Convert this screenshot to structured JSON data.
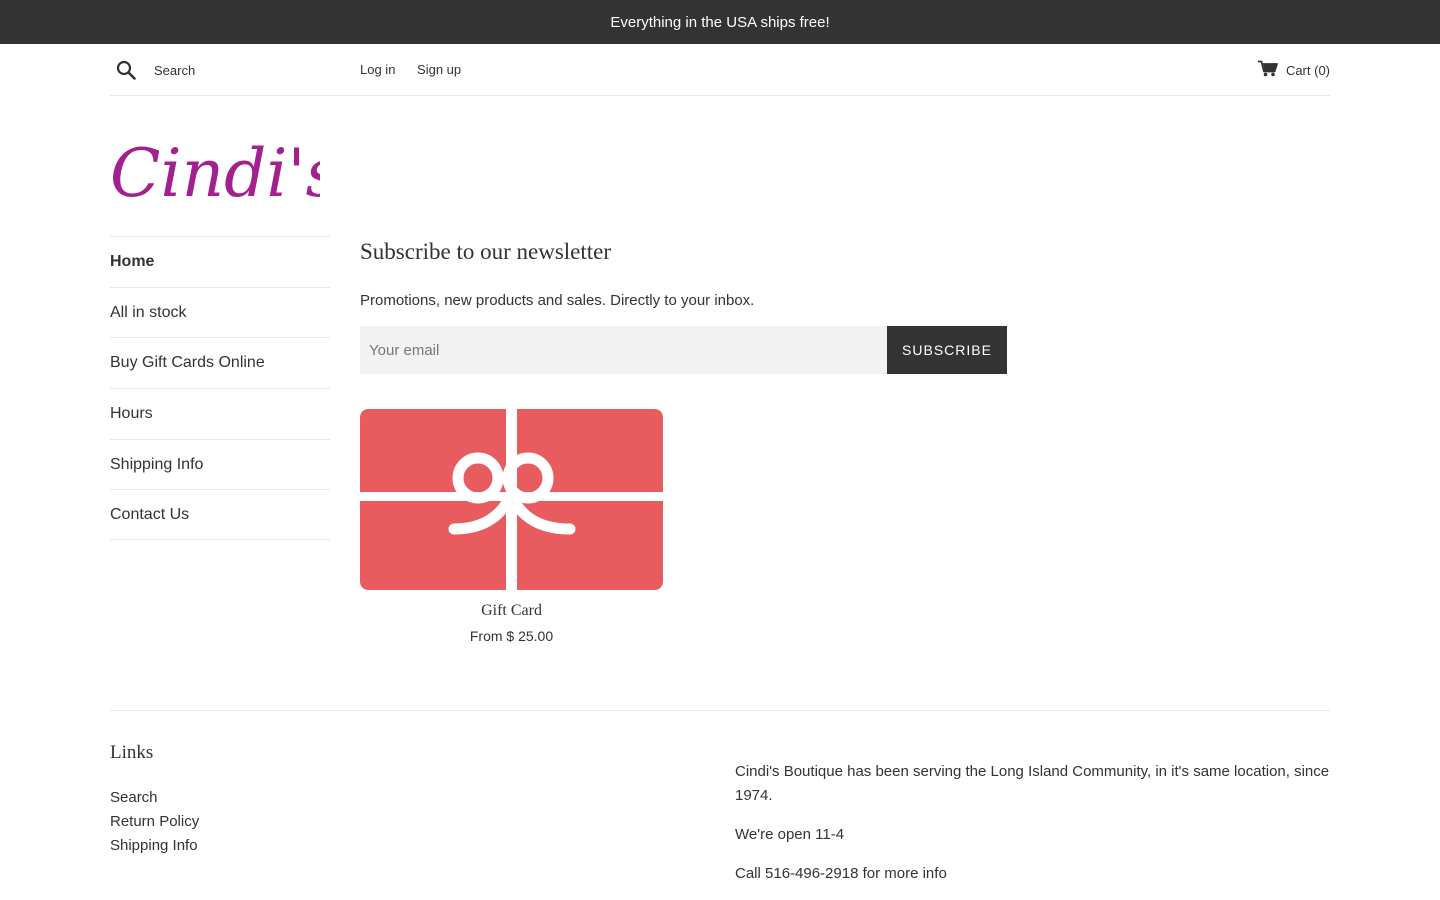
{
  "announcement": {
    "text": "Everything in the USA ships free!"
  },
  "header": {
    "search_placeholder": "Search",
    "login_label": "Log in",
    "signup_label": "Sign up",
    "cart_label": "Cart (0)"
  },
  "logo": {
    "text": "Cindi's",
    "color": "#a3208f"
  },
  "sidebar": {
    "items": [
      {
        "label": "Home",
        "active": true
      },
      {
        "label": "All in stock"
      },
      {
        "label": "Buy Gift Cards Online"
      },
      {
        "label": "Hours"
      },
      {
        "label": "Shipping Info"
      },
      {
        "label": "Contact Us"
      }
    ]
  },
  "newsletter": {
    "title": "Subscribe to our newsletter",
    "description": "Promotions, new products and sales. Directly to your inbox.",
    "email_placeholder": "Your email",
    "button_label": "SUBSCRIBE"
  },
  "product": {
    "title": "Gift Card",
    "price": "From $ 25.00",
    "card_color": "#e85c5f"
  },
  "footer": {
    "links_heading": "Links",
    "links": [
      {
        "label": "Search"
      },
      {
        "label": "Return Policy"
      },
      {
        "label": "Shipping Info"
      }
    ],
    "about": [
      "Cindi's Boutique has been serving the Long Island Community, in it's same location, since 1974.",
      "We're open 11-4",
      "Call 516-496-2918 for more info"
    ]
  },
  "colors": {
    "dark": "#333333",
    "border": "#e8e8e8",
    "input_bg": "#f2f2f2"
  }
}
